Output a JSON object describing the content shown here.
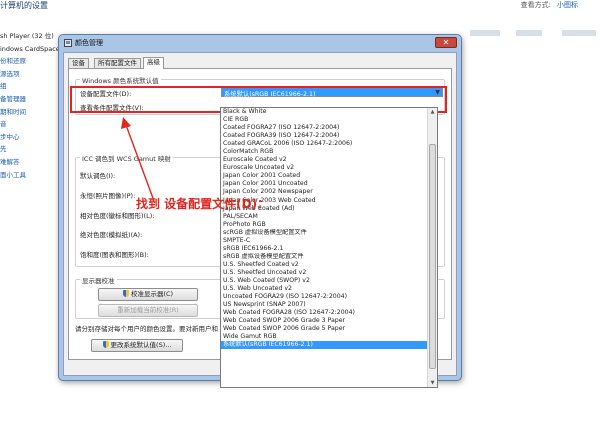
{
  "background": {
    "title": "计算机的设置",
    "right_label": "查看方式:",
    "right_link": "小图标",
    "sidebar_items": [
      {
        "label": "sh Player (32 位)",
        "dark": true
      },
      {
        "label": "indows CardSpace",
        "dark": true
      },
      {
        "label": "份和还原",
        "dark": false
      },
      {
        "label": "源选项",
        "dark": false
      },
      {
        "label": "组",
        "dark": false
      },
      {
        "label": "备管理器",
        "dark": false
      },
      {
        "label": "期和时间",
        "dark": false
      },
      {
        "label": "音",
        "dark": false
      },
      {
        "label": "步中心",
        "dark": false
      },
      {
        "label": "先",
        "dark": false
      },
      {
        "label": "难解答",
        "dark": false
      },
      {
        "label": "面小工具",
        "dark": false
      }
    ]
  },
  "dialog": {
    "title": "颜色管理",
    "close_glyph": "✕",
    "tabs": [
      {
        "label": "设备",
        "active": false
      },
      {
        "label": "所有配置文件",
        "active": false
      },
      {
        "label": "高级",
        "active": true
      }
    ],
    "defaults_group_title": "Windows 颜色系统默认值",
    "device_profile_label": "设备配置文件(D):",
    "device_profile_value": "系统默认(sRGB IEC61966-2.1)",
    "viewing_conditions_label": "查看条件配置文件(V):",
    "icc_group_title": "ICC 调色到 WCS Gamut 映射",
    "mapping_labels": [
      "默认调色(I):",
      "永恒(照片图像)(P):",
      "相对色度(徽标和图形)(L):",
      "绝对色度(模拟纸)(A):",
      "饱和度(图表和图形)(B):"
    ],
    "calibration_group_title": "显示器校准",
    "calibrate_button": "校准显示器(C)",
    "reload_button": "重新加载当前校准(R)",
    "footer_text": "请分别存储对每个用户的颜色设置。要对新用户和",
    "change_defaults_button": "更改系统默认值(S)..."
  },
  "dropdown": {
    "items": [
      "Black & White",
      "CIE RGB",
      "Coated FOGRA27 (ISO 12647-2:2004)",
      "Coated FOGRA39 (ISO 12647-2:2004)",
      "Coated GRACoL 2006 (ISO 12647-2:2006)",
      "ColorMatch RGB",
      "Euroscale Coated v2",
      "Euroscale Uncoated v2",
      "Japan Color 2001 Coated",
      "Japan Color 2001 Uncoated",
      "Japan Color 2002 Newspaper",
      "Japan Color 2003 Web Coated",
      "Japan Web Coated (Ad)",
      "PAL/SECAM",
      "ProPhoto RGB",
      "scRGB 虚拟设备模型配置文件",
      "SMPTE-C",
      "sRGB IEC61966-2.1",
      "sRGB 虚拟设备模型配置文件",
      "U.S. Sheetfed Coated v2",
      "U.S. Sheetfed Uncoated v2",
      "U.S. Web Coated (SWOP) v2",
      "U.S. Web Uncoated v2",
      "Uncoated FOGRA29 (ISO 12647-2:2004)",
      "US Newsprint (SNAP 2007)",
      "Web Coated FOGRA28 (ISO 12647-2:2004)",
      "Web Coated SWOP 2006 Grade 3 Paper",
      "Web Coated SWOP 2006 Grade 5 Paper",
      "Wide Gamut RGB",
      "系统默认(sRGB IEC61966-2.1)"
    ],
    "selected_index": 29
  },
  "annotation": {
    "text": "找到  设备配置文件(D)：",
    "color": "#e0261d"
  }
}
